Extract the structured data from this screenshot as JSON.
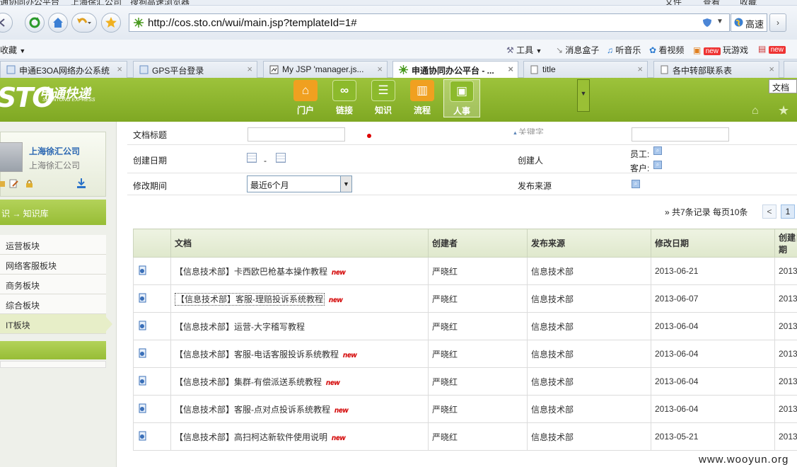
{
  "browser": {
    "top_strip": [
      "通协同办公平台",
      "上海徐汇公司",
      "搜狗高速浏览器",
      "文件",
      "查看",
      "收藏"
    ],
    "url": "http://cos.sto.cn/wui/main.jsp?templateId=1#",
    "speed_label": "高速",
    "favorites": {
      "collapsed": "收藏",
      "tools": "工具",
      "items": [
        "消息盒子",
        "听音乐",
        "看视频",
        "玩游戏"
      ],
      "new_badge": "new"
    },
    "tabs": [
      {
        "label": "申通E3OA网络办公系统"
      },
      {
        "label": "GPS平台登录"
      },
      {
        "label": "My JSP 'manager.js..."
      },
      {
        "label": "申通协同办公平台 - ...",
        "active": true
      },
      {
        "label": "title"
      },
      {
        "label": "各中转部联系表"
      }
    ]
  },
  "app": {
    "logo_text": "STO",
    "logo_cn": "申通快递",
    "logo_en": "SHENTONG EXPRESS",
    "modules": [
      {
        "label": "门户",
        "icon": "home-icon",
        "color": "#f0a020"
      },
      {
        "label": "链接",
        "icon": "link-icon",
        "color": "#8cba2c"
      },
      {
        "label": "知识",
        "icon": "knowledge-icon",
        "color": "#8cba2c"
      },
      {
        "label": "流程",
        "icon": "workflow-icon",
        "color": "#f0a020"
      },
      {
        "label": "人事",
        "icon": "hr-icon",
        "color": "#8cba2c",
        "selected": true
      }
    ],
    "doc_select": "文档"
  },
  "sidebar": {
    "company_main": "上海徐汇公司",
    "company_sub": "上海徐汇公司",
    "breadcrumb": "识 → 知识库",
    "boards": [
      {
        "label": "运营板块"
      },
      {
        "label": "网络客服板块"
      },
      {
        "label": "商务板块"
      },
      {
        "label": "综合板块"
      },
      {
        "label": "IT板块",
        "active": true
      }
    ]
  },
  "filters": {
    "doc_title_label": "文档标题",
    "keyword_label": "关键字",
    "create_date_label": "创建日期",
    "date_sep": "-",
    "creator_label": "创建人",
    "employee_label": "员工:",
    "customer_label": "客户:",
    "modify_period_label": "修改期间",
    "modify_period_value": "最近6个月",
    "source_label": "发布来源"
  },
  "pager": {
    "info": "» 共7条记录    每页10条",
    "prev": "<",
    "current": "1"
  },
  "table": {
    "columns": [
      "",
      "文档",
      "创建者",
      "发布来源",
      "修改日期",
      "创建日期"
    ],
    "rows": [
      {
        "title": "【信息技术部】卡西欧巴枪基本操作教程",
        "new": true,
        "creator": "严晓红",
        "source": "信息技术部",
        "modified": "2013-06-21",
        "created": "2013"
      },
      {
        "title": "【信息技术部】客服-理赔投诉系统教程",
        "new": true,
        "focused": true,
        "creator": "严晓红",
        "source": "信息技术部",
        "modified": "2013-06-07",
        "created": "2013"
      },
      {
        "title": "【信息技术部】运营-大字稽写教程",
        "new": false,
        "creator": "严晓红",
        "source": "信息技术部",
        "modified": "2013-06-04",
        "created": "2013"
      },
      {
        "title": "【信息技术部】客服-电话客服投诉系统教程",
        "new": true,
        "creator": "严晓红",
        "source": "信息技术部",
        "modified": "2013-06-04",
        "created": "2013"
      },
      {
        "title": "【信息技术部】集群-有偿派送系统教程",
        "new": true,
        "creator": "严晓红",
        "source": "信息技术部",
        "modified": "2013-06-04",
        "created": "2013"
      },
      {
        "title": "【信息技术部】客服-点对点投诉系统教程",
        "new": true,
        "creator": "严晓红",
        "source": "信息技术部",
        "modified": "2013-06-04",
        "created": "2013"
      },
      {
        "title": "【信息技术部】高扫柯达新软件使用说明",
        "new": true,
        "creator": "严晓红",
        "source": "信息技术部",
        "modified": "2013-05-21",
        "created": "2013"
      }
    ],
    "new_tag": "new"
  },
  "watermark": "www.wooyun.org"
}
